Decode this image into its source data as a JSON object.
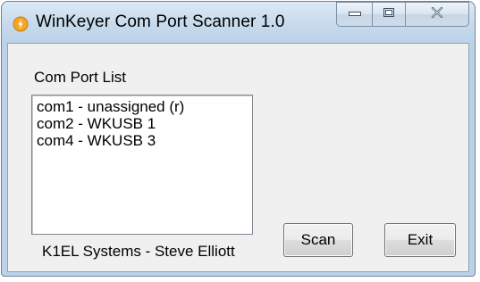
{
  "window": {
    "title": "WinKeyer Com Port Scanner 1.0"
  },
  "title_controls": {
    "minimize_icon": "minimize-icon",
    "maximize_icon": "maximize-icon",
    "close_icon": "close-icon"
  },
  "com_port_group": {
    "label": "Com Port List",
    "items": [
      {
        "label": "com1 - unassigned (r)"
      },
      {
        "label": "com2 - WKUSB 1"
      },
      {
        "label": "com4 - WKUSB 3"
      }
    ]
  },
  "footer": {
    "credit": "K1EL Systems - Steve Elliott"
  },
  "buttons": {
    "scan_label": "Scan",
    "exit_label": "Exit"
  },
  "colors": {
    "titlebar": "#c9dced",
    "client_background": "#f0f0f0",
    "app_icon_fill": "#f5a623"
  }
}
